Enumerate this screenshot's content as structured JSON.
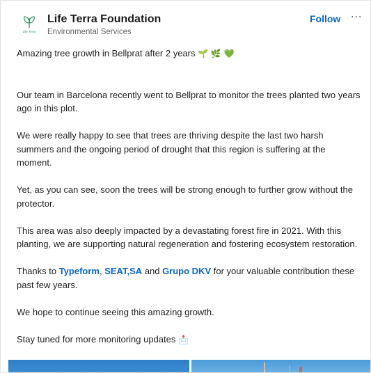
{
  "org": {
    "name": "Life Terra Foundation",
    "subtitle": "Environmental Services",
    "logo_text": "Life Terra",
    "logo_icon": "leaf-logo-icon"
  },
  "actions": {
    "follow_label": "Follow",
    "more_label": "···"
  },
  "post": {
    "headline": "Amazing tree growth in Bellprat after 2 years",
    "headline_emojis": "🌱 🌿 💚",
    "paragraphs": [
      "Our team in Barcelona recently went to Bellprat to monitor the trees planted two years ago in this plot.",
      "We were really happy to see that trees are thriving despite the last two harsh summers and the ongoing period of drought that this region is suffering at the moment.",
      "Yet, as you can see, soon the trees will be strong enough to further grow without the protector.",
      "This area was also deeply impacted by a devastating forest fire in 2021. With this planting, we are supporting natural regeneration and fostering ecosystem restoration."
    ],
    "thanks": {
      "prefix": "Thanks to ",
      "mention1": "Typeform",
      "sep1": ", ",
      "mention2": "SEAT,SA",
      "sep2": " and ",
      "mention3": "Grupo DKV",
      "suffix": " for your valuable contribution these past few years."
    },
    "hope": "We hope to continue seeing this amazing growth.",
    "stay_tuned": "Stay tuned for more monitoring updates",
    "stay_tuned_emoji": "📩"
  },
  "colors": {
    "accent": "#0a66c2",
    "logo_green": "#3a9a6b"
  }
}
